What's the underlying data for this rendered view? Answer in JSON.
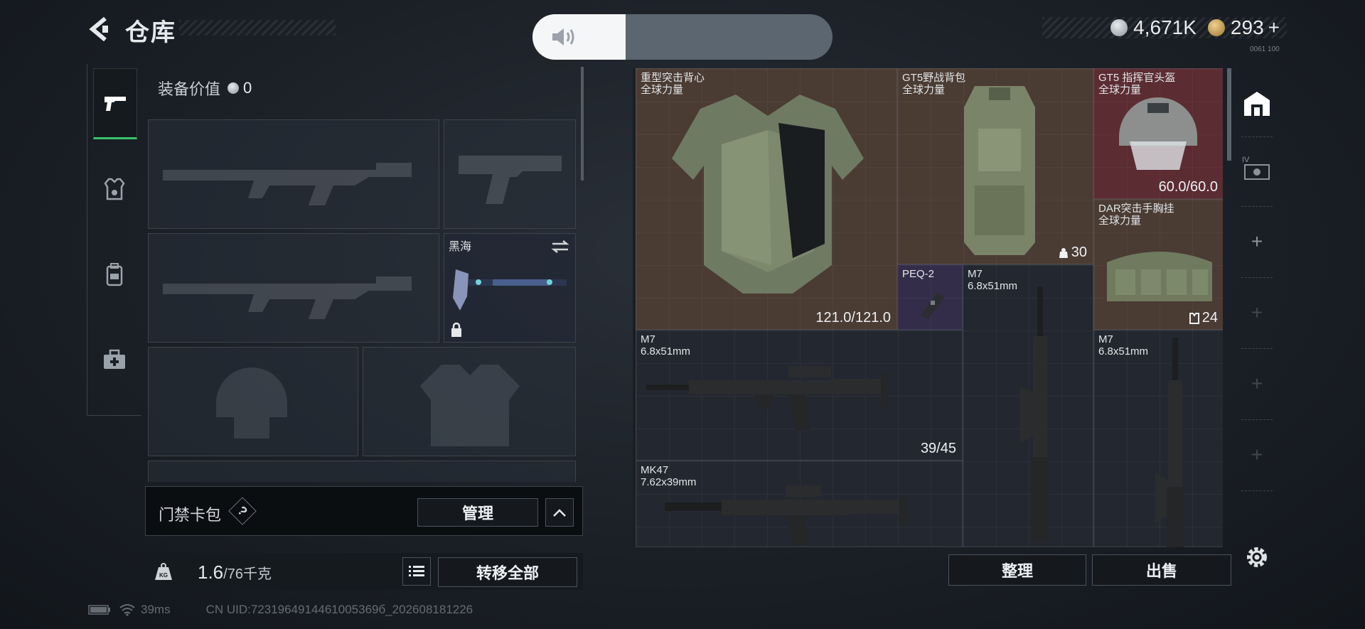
{
  "header": {
    "title": "仓库",
    "currency": [
      {
        "icon": "silver-coin-icon",
        "value": "4,671K",
        "color": "#b9bec4"
      },
      {
        "icon": "gold-coin-icon",
        "value": "293",
        "color": "#c9a25a"
      }
    ],
    "add_label": "+",
    "voice_level": 0.31,
    "corner_mark": "0061 100"
  },
  "sidebar": {
    "tabs": [
      {
        "icon": "pistol-icon",
        "active": true
      },
      {
        "icon": "armor-icon",
        "active": false
      },
      {
        "icon": "backpack-icon",
        "active": false
      },
      {
        "icon": "medkit-icon",
        "active": false
      }
    ]
  },
  "loadout": {
    "equip_value_label": "装备价值",
    "equip_value": "0",
    "melee_name": "黑海",
    "card_pack_label": "门禁卡包",
    "help_label": "?",
    "manage_label": "管理",
    "weight_value": "1.6",
    "weight_capacity": "/76千克",
    "transfer_all_label": "转移全部",
    "kg_label": "KG"
  },
  "stash": {
    "items": [
      {
        "id": "vest",
        "name": "重型突击背心\n全球力量",
        "value": "121.0/121.0"
      },
      {
        "id": "backpack",
        "name": "GT5野战背包\n全球力量",
        "value": "30"
      },
      {
        "id": "helmet",
        "name": "GT5 指挥官头盔\n全球力量",
        "value": "60.0/60.0"
      },
      {
        "id": "chestrig",
        "name": "DAR突击手胸挂\n全球力量",
        "value": "24"
      },
      {
        "id": "peq",
        "name": "PEQ-2",
        "value": ""
      },
      {
        "id": "m7-vertical",
        "name": "M7\n6.8x51mm",
        "value": ""
      },
      {
        "id": "m7-horizontal",
        "name": "M7\n6.8x51mm",
        "value": "39/45"
      },
      {
        "id": "m7-vertical-2",
        "name": "M7\n6.8x51mm",
        "value": ""
      },
      {
        "id": "mk47",
        "name": "MK47\n7.62x39mm",
        "value": ""
      }
    ],
    "sort_label": "整理",
    "sell_label": "出售"
  },
  "rail": {
    "items": [
      "warehouse-icon",
      "storage-iv-icon",
      "add-icon",
      "add-icon",
      "add-icon",
      "add-icon",
      "add-icon"
    ],
    "add_label": "+",
    "iv_label": "IV"
  },
  "status": {
    "ping": "39ms",
    "uid": "CN UID:7231964914461005369б_202608181226"
  }
}
